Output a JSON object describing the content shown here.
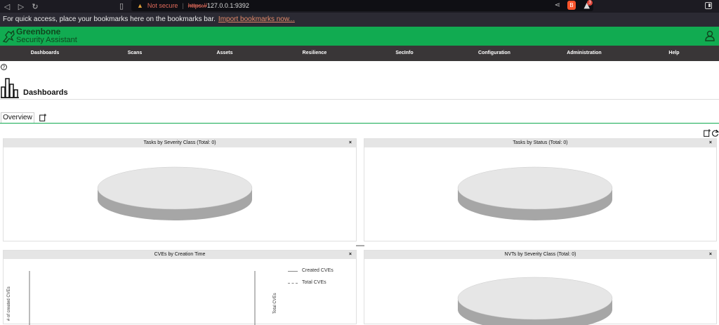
{
  "browser": {
    "not_secure": "Not secure",
    "url_scheme": "https://",
    "url_host": "127.0.0.1:9392",
    "rewards_count": "3"
  },
  "bookmarks": {
    "message": "For quick access, place your bookmarks here on the bookmarks bar.",
    "import_link": "Import bookmarks now..."
  },
  "app": {
    "brand_line1": "Greenbone",
    "brand_line2": "Security Assistant",
    "brand_color": "#11ab51",
    "menu_bg": "#393637"
  },
  "menu": {
    "items": [
      "Dashboards",
      "Scans",
      "Assets",
      "Resilience",
      "SecInfo",
      "Configuration",
      "Administration",
      "Help"
    ]
  },
  "page": {
    "title": "Dashboards",
    "tab_overview": "Overview"
  },
  "panels": [
    {
      "title": "Tasks by Severity Class (Total: 0)",
      "close": "×"
    },
    {
      "title": "Tasks by Status (Total: 0)",
      "close": "×"
    },
    {
      "title": "CVEs by Creation Time",
      "close": "×"
    },
    {
      "title": "NVTs by Severity Class (Total: 0)",
      "close": "×"
    }
  ],
  "cve_chart": {
    "y_left_label": "# of created CVEs",
    "y_right_label": "Total CVEs",
    "legend_created": "Created CVEs",
    "legend_total": "Total CVEs"
  }
}
